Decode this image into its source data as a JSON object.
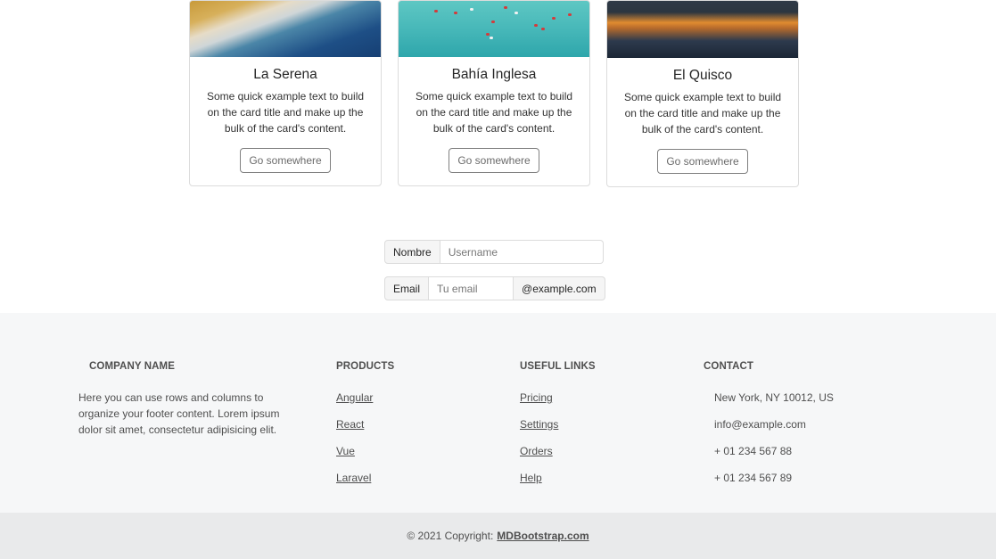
{
  "cards": [
    {
      "title": "La Serena",
      "text": "Some quick example text to build on the card title and make up the bulk of the card's content.",
      "button": "Go somewhere"
    },
    {
      "title": "Bahía Inglesa",
      "text": "Some quick example text to build on the card title and make up the bulk of the card's content.",
      "button": "Go somewhere"
    },
    {
      "title": "El Quisco",
      "text": "Some quick example text to build on the card title and make up the bulk of the card's content.",
      "button": "Go somewhere"
    }
  ],
  "form": {
    "name_label": "Nombre",
    "name_placeholder": "Username",
    "email_label": "Email",
    "email_placeholder": "Tu email",
    "email_suffix": "@example.com"
  },
  "footer": {
    "company": {
      "heading": "COMPANY NAME",
      "text": "Here you can use rows and columns to organize your footer content. Lorem ipsum dolor sit amet, consectetur adipisicing elit."
    },
    "products": {
      "heading": "PRODUCTS",
      "items": [
        "Angular",
        "React",
        "Vue",
        "Laravel"
      ]
    },
    "links": {
      "heading": "USEFUL LINKS",
      "items": [
        "Pricing",
        "Settings",
        "Orders",
        "Help"
      ]
    },
    "contact": {
      "heading": "CONTACT",
      "items": [
        "New York, NY 10012, US",
        "info@example.com",
        "+ 01 234 567 88",
        "+ 01 234 567 89"
      ]
    }
  },
  "copyright": {
    "prefix": "© 2021 Copyright:",
    "link": "MDBootstrap.com"
  }
}
